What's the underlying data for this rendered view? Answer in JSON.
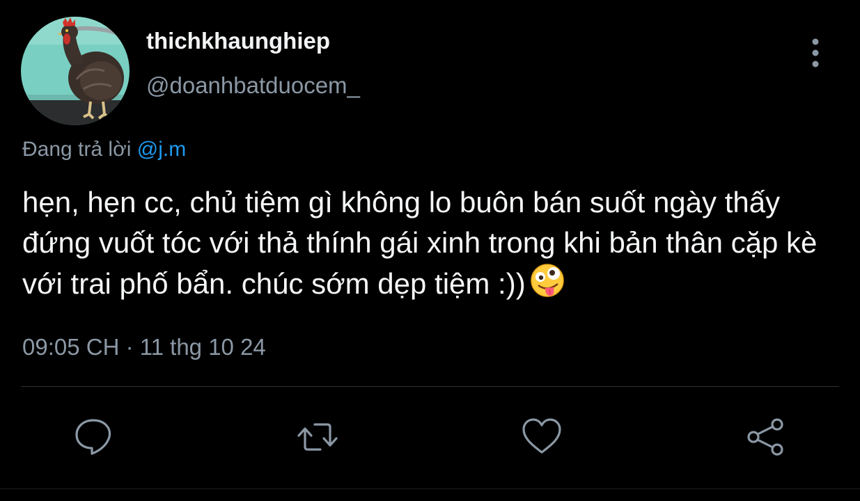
{
  "tweet": {
    "display_name": "thichkhaunghiep",
    "handle": "@doanhbatduocem_",
    "reply_prefix": "Đang trả lời ",
    "reply_to": "@j.m",
    "text": "hẹn, hẹn cc, chủ tiệm gì không lo buôn bán suốt ngày thấy đứng vuốt tóc với thả thính gái xinh trong khi bản thân cặp kè với trai phố bẩn. chúc sớm dẹp tiệm :))",
    "emoji": "zany-face",
    "timestamp": "09:05 CH · 11 thg 10 24"
  },
  "icons": {
    "more": "more-vertical-icon",
    "reply": "comment-icon",
    "retweet": "retweet-icon",
    "like": "heart-icon",
    "share": "share-icon"
  },
  "colors": {
    "background": "#000000",
    "text": "#f5f6f7",
    "secondary": "#8b98a5",
    "accent": "#1d9bf0",
    "divider": "#2f3336"
  }
}
